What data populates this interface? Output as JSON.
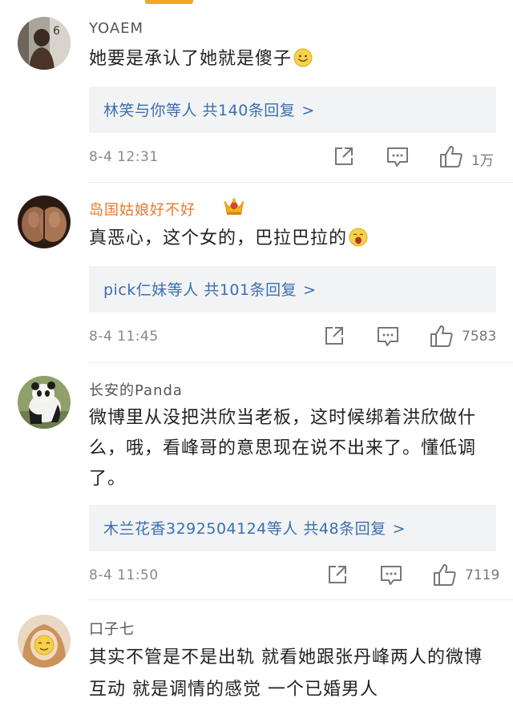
{
  "comments": [
    {
      "username": "YOAEM",
      "text": "她要是承认了她就是傻子",
      "emoji": "smile-emoji",
      "replies": "林笑与你等人 共140条回复",
      "time": "8-4 12:31",
      "likes": "1万"
    },
    {
      "username": "岛国姑娘好不好",
      "badge": "crown-badge",
      "text": "真恶心，这个女的，巴拉巴拉的",
      "emoji": "yawn-emoji",
      "replies": "pick仁妹等人 共101条回复",
      "time": "8-4 11:45",
      "likes": "7583"
    },
    {
      "username": "长安的Panda",
      "text": "微博里从没把洪欣当老板，这时候绑着洪欣做什么，哦，看峰哥的意思现在说不出来了。懂低调了。",
      "replies": "木兰花香3292504124等人 共48条回复",
      "time": "8-4 11:50",
      "likes": "7119"
    },
    {
      "username": "口子七",
      "text": "其实不管是不是出轨 就看她跟张丹峰两人的微博互动 就是调情的感觉 一个已婚男人"
    }
  ],
  "reply_arrow": ">",
  "icons": {
    "share": "share-icon",
    "comment": "comment-icon",
    "like": "like-icon"
  },
  "colors": {
    "accent": "#f5a623",
    "link": "#3a6fb0",
    "vip_name": "#e8772e",
    "reply_bg": "#f2f3f5"
  }
}
